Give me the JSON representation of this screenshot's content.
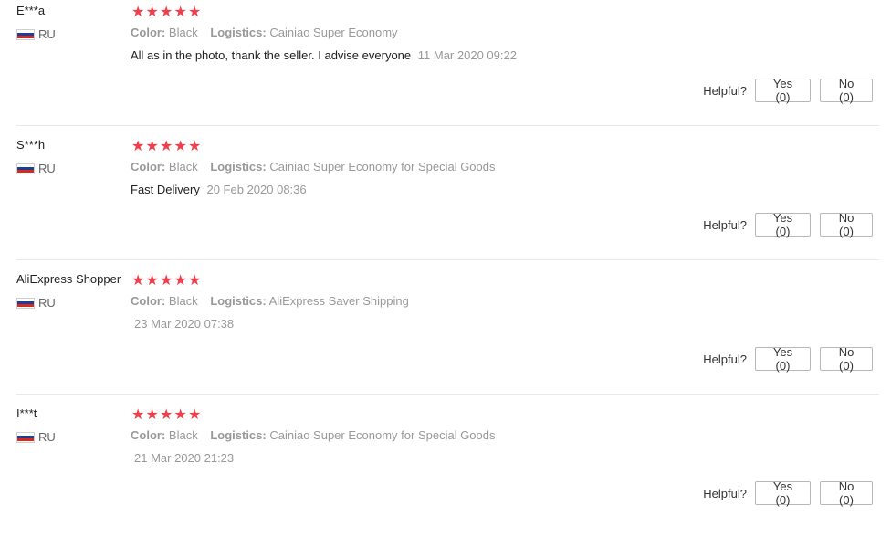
{
  "helpful_label": "Helpful?",
  "flag_colors": [
    "#ffffff",
    "#1c3f94",
    "#d52b1e"
  ],
  "star_color": "#ef3f4c",
  "reviews": [
    {
      "name": "E***a",
      "country": "RU",
      "rating": 5,
      "stars": [
        "★",
        "★",
        "★",
        "★",
        "★"
      ],
      "color_label": "Color:",
      "color_value": "Black",
      "logistics_label": "Logistics:",
      "logistics_value": "Cainiao Super Economy",
      "text": "All as in the photo, thank the seller. I advise everyone",
      "date": "11 Mar 2020 09:22",
      "yes": "Yes (0)",
      "no": "No (0)"
    },
    {
      "name": "S***h",
      "country": "RU",
      "rating": 5,
      "stars": [
        "★",
        "★",
        "★",
        "★",
        "★"
      ],
      "color_label": "Color:",
      "color_value": "Black",
      "logistics_label": "Logistics:",
      "logistics_value": "Cainiao Super Economy for Special Goods",
      "text": "Fast Delivery",
      "date": "20 Feb 2020 08:36",
      "yes": "Yes (0)",
      "no": "No (0)"
    },
    {
      "name": "AliExpress Shopper",
      "country": "RU",
      "rating": 5,
      "stars": [
        "★",
        "★",
        "★",
        "★",
        "★"
      ],
      "color_label": "Color:",
      "color_value": "Black",
      "logistics_label": "Logistics:",
      "logistics_value": "AliExpress Saver Shipping",
      "text": "",
      "date": "23 Mar 2020 07:38",
      "yes": "Yes (0)",
      "no": "No (0)"
    },
    {
      "name": "I***t",
      "country": "RU",
      "rating": 5,
      "stars": [
        "★",
        "★",
        "★",
        "★",
        "★"
      ],
      "color_label": "Color:",
      "color_value": "Black",
      "logistics_label": "Logistics:",
      "logistics_value": "Cainiao Super Economy for Special Goods",
      "text": "",
      "date": "21 Mar 2020 21:23",
      "yes": "Yes (0)",
      "no": "No (0)"
    }
  ]
}
